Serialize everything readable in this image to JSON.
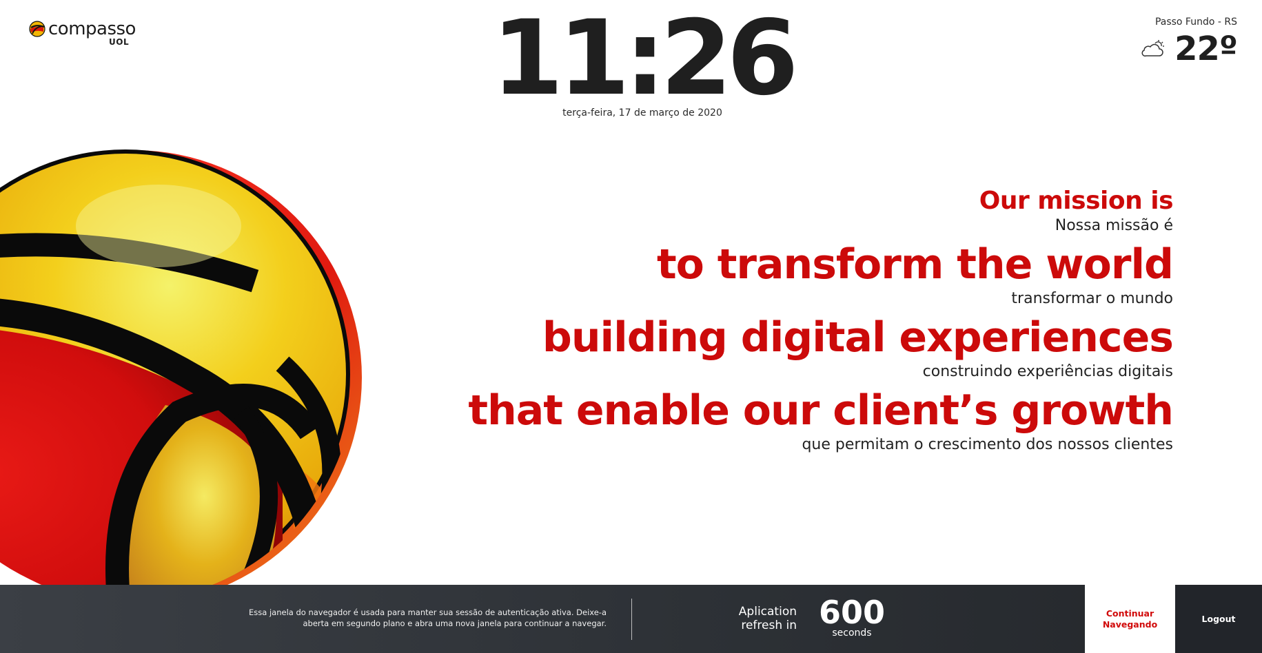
{
  "brand": {
    "logo_text": "compasso",
    "logo_sub": "UOL",
    "primary_color": "#cc0a0a"
  },
  "clock": {
    "time": "11:26",
    "date": "terça-feira, 17 de março de 2020"
  },
  "weather": {
    "city": "Passo Fundo - RS",
    "temperature": "22º",
    "icon": "cloudy-sun-icon"
  },
  "mission": {
    "lines": [
      {
        "en": "Our mission is",
        "pt": "Nossa missão é"
      },
      {
        "en": "to transform the world",
        "pt": "transformar o mundo"
      },
      {
        "en": "building digital experiences",
        "pt": "construindo experiências digitais"
      },
      {
        "en": "that enable our client’s growth",
        "pt": "que permitam o crescimento dos nossos clientes"
      }
    ]
  },
  "footer": {
    "note": "Essa janela do navegador é usada para manter sua sessão de autenticação ativa. Deixe-a aberta em segundo plano e abra uma nova janela para continuar a navegar.",
    "refresh_label": "Aplication refresh in",
    "refresh_count": "600",
    "refresh_unit": "seconds",
    "continue_label": "Continuar Navegando",
    "logout_label": "Logout",
    "background_color": "#2d3136"
  }
}
